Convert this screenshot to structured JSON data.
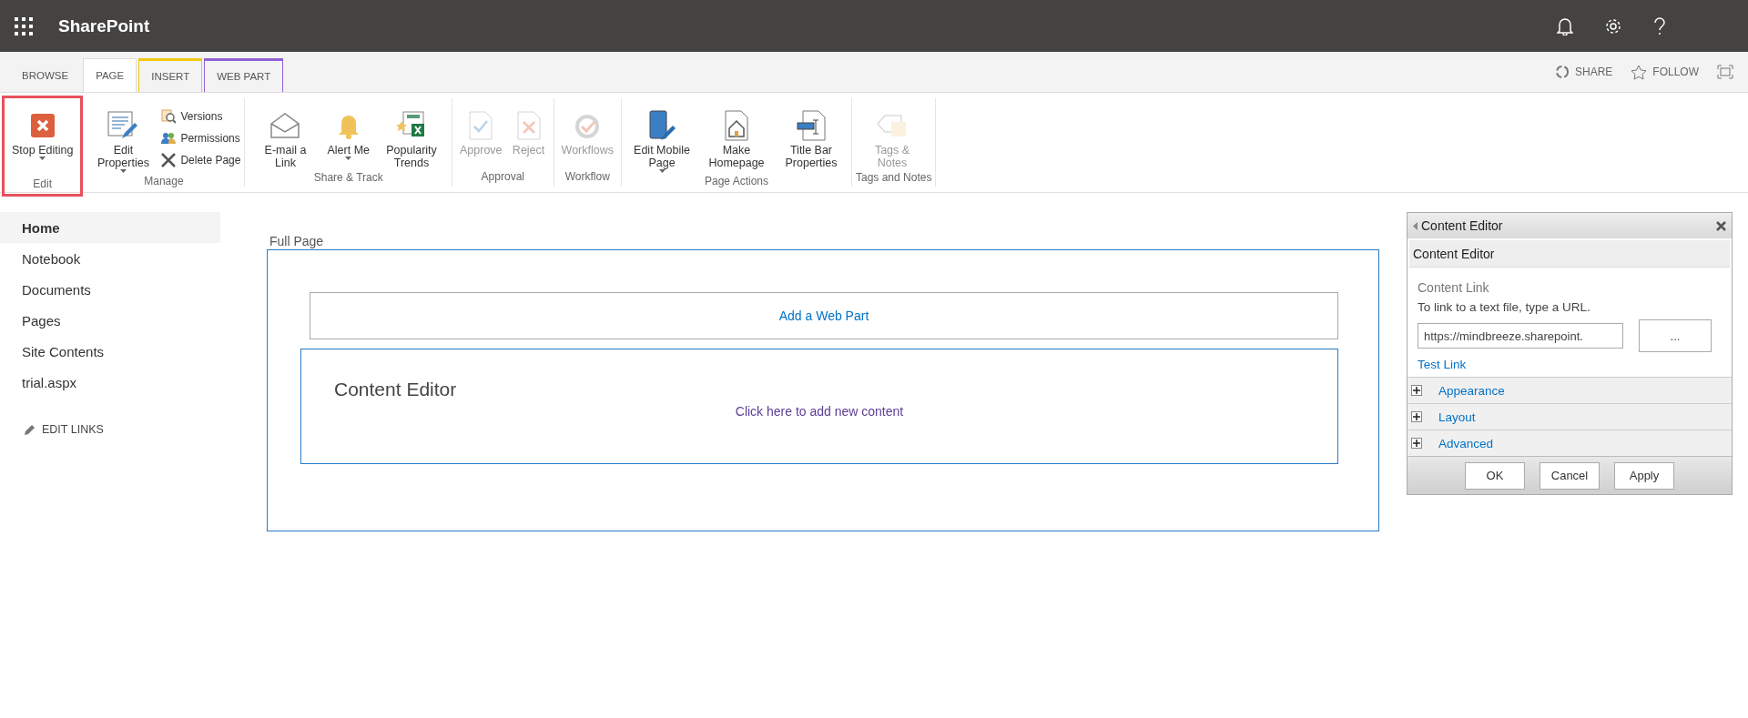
{
  "suite_bar": {
    "title": "SharePoint"
  },
  "ribbon_tabs": [
    {
      "label": "BROWSE",
      "selected": false
    },
    {
      "label": "PAGE",
      "selected": true
    },
    {
      "label": "INSERT",
      "selected": false,
      "color": "#f2c811"
    },
    {
      "label": "WEB PART",
      "selected": false,
      "color": "#9161d6"
    }
  ],
  "ribbon_actions": [
    {
      "label": "SHARE"
    },
    {
      "label": "FOLLOW"
    }
  ],
  "ribbon_groups": [
    {
      "label": "Edit",
      "highlighted": true,
      "items": [
        {
          "kind": "large",
          "label": "Stop Editing",
          "dropdown": true,
          "disabled": false
        }
      ]
    },
    {
      "label": "Manage",
      "highlighted": false,
      "items": [
        {
          "kind": "large",
          "label": "Edit Properties",
          "dropdown": true,
          "disabled": false
        },
        {
          "kind": "small",
          "label": "Versions",
          "disabled": false
        },
        {
          "kind": "small",
          "label": "Permissions",
          "disabled": false
        },
        {
          "kind": "small",
          "label": "Delete Page",
          "disabled": false
        }
      ]
    },
    {
      "label": "Share & Track",
      "highlighted": false,
      "items": [
        {
          "kind": "large",
          "label": "E-mail a Link",
          "dropdown": false,
          "disabled": false
        },
        {
          "kind": "large",
          "label": "Alert Me",
          "dropdown": true,
          "disabled": false
        },
        {
          "kind": "large",
          "label": "Popularity Trends",
          "dropdown": false,
          "disabled": false
        }
      ]
    },
    {
      "label": "Approval",
      "highlighted": false,
      "items": [
        {
          "kind": "large",
          "label": "Approve",
          "dropdown": false,
          "disabled": true
        },
        {
          "kind": "large",
          "label": "Reject",
          "dropdown": false,
          "disabled": true
        }
      ]
    },
    {
      "label": "Workflow",
      "highlighted": false,
      "items": [
        {
          "kind": "large",
          "label": "Workflows",
          "dropdown": false,
          "disabled": true
        }
      ]
    },
    {
      "label": "Page Actions",
      "highlighted": false,
      "items": [
        {
          "kind": "large",
          "label": "Edit Mobile Page",
          "dropdown": true,
          "disabled": false
        },
        {
          "kind": "large",
          "label": "Make Homepage",
          "dropdown": false,
          "disabled": false
        },
        {
          "kind": "large",
          "label": "Title Bar Properties",
          "dropdown": false,
          "disabled": false
        }
      ]
    },
    {
      "label": "Tags and Notes",
      "highlighted": false,
      "items": [
        {
          "kind": "large",
          "label": "Tags & Notes",
          "dropdown": false,
          "disabled": true
        }
      ]
    }
  ],
  "sidebar": {
    "items": [
      {
        "label": "Home",
        "selected": true
      },
      {
        "label": "Notebook",
        "selected": false
      },
      {
        "label": "Documents",
        "selected": false
      },
      {
        "label": "Pages",
        "selected": false
      },
      {
        "label": "Site Contents",
        "selected": false
      },
      {
        "label": "trial.aspx",
        "selected": false
      }
    ],
    "edit_links": "EDIT LINKS"
  },
  "zone": {
    "title": "Full Page",
    "add_web_part": "Add a Web Part",
    "web_part": {
      "title": "Content Editor",
      "link": "Click here to add new content"
    }
  },
  "tool_pane": {
    "title": "Content Editor",
    "section_title": "Content Editor",
    "field_label": "Content Link",
    "hint": "To link to a text file, type a URL.",
    "value": "https://mindbreeze.sharepoint.",
    "browse_button": "...",
    "test_link": "Test Link",
    "sections": [
      {
        "label": "Appearance",
        "expanded": false
      },
      {
        "label": "Layout",
        "expanded": false
      },
      {
        "label": "Advanced",
        "expanded": false
      }
    ],
    "buttons": [
      "OK",
      "Cancel",
      "Apply"
    ]
  }
}
